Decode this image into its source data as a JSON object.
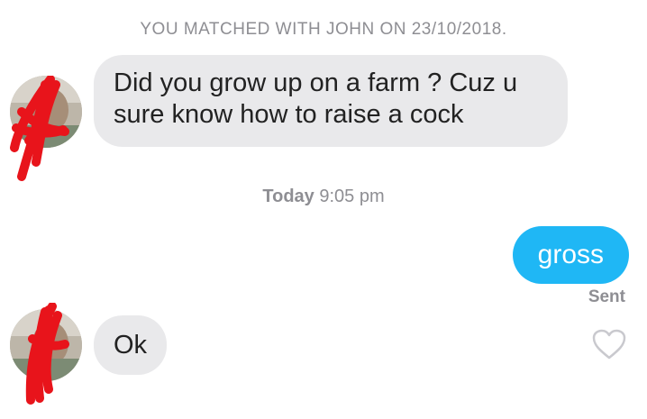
{
  "match_banner": "YOU MATCHED WITH JOHN ON 23/10/2018.",
  "messages": [
    {
      "direction": "incoming",
      "text": "Did you grow up on a farm ? Cuz u sure know how to raise a cock"
    },
    {
      "direction": "outgoing",
      "text": "gross",
      "status": "Sent"
    },
    {
      "direction": "incoming",
      "text": "Ok"
    }
  ],
  "timestamp": {
    "day": "Today",
    "time": "9:05 pm"
  },
  "colors": {
    "incoming_bubble": "#e9e9eb",
    "outgoing_bubble": "#1fb7f5",
    "meta_text": "#8e8e93",
    "redaction": "#e8141b"
  },
  "icons": {
    "like": "heart-outline-icon"
  }
}
